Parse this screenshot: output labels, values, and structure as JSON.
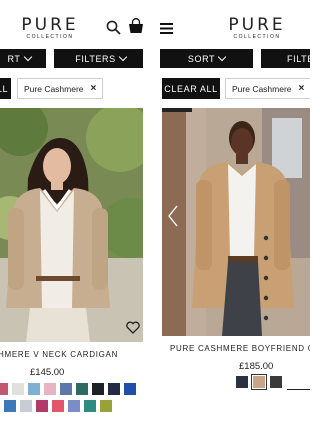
{
  "brand": {
    "name": "PURE",
    "tagline": "COLLECTION"
  },
  "toolbar": {
    "sort_label": "SORT",
    "filters_label": "FILTERS",
    "clear_all_label": "CLEAR ALL"
  },
  "filter_chip": {
    "label": "Pure Cashmere",
    "remove": "×"
  },
  "left": {
    "sort_label": "RT",
    "clear_all_label": "LL",
    "product": {
      "title": "HMERE V NECK CARDIGAN",
      "price": "£145.00",
      "swatches": [
        "#c4566e",
        "#e0e0dc",
        "#7fb0d2",
        "#e6b4c2",
        "#5d78a8",
        "#2d6b62",
        "#1d2226",
        "#222b44",
        "#1f4fa8",
        "#3e78b6",
        "#c8ccd4",
        "#b23a6a",
        "#e2566b",
        "#7c8cc6",
        "#2f8b80",
        "#98a238"
      ]
    }
  },
  "right": {
    "product": {
      "title": "PURE CASHMERE BOYFRIEND CA",
      "price": "£185.00",
      "swatches": [
        "#2a3240",
        "#c8a58a",
        "#3a3a3a"
      ]
    }
  },
  "colors": {
    "black": "#111111",
    "beige": "#c8a58a"
  }
}
